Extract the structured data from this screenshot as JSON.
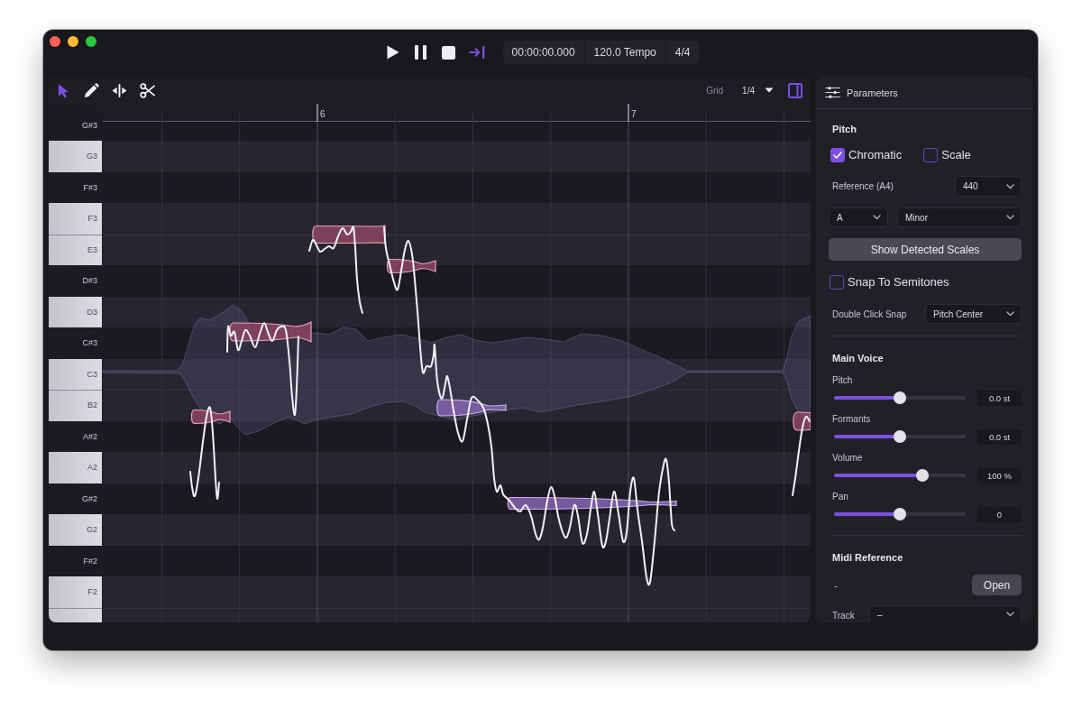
{
  "transport": {
    "buttons": [
      {
        "kind": "play",
        "on": false
      },
      {
        "kind": "pause",
        "on": false
      },
      {
        "kind": "stop",
        "on": false
      },
      {
        "kind": "end",
        "on": true
      }
    ],
    "readouts": [
      "00:00:00.000",
      "120.0 Tempo",
      "4/4"
    ]
  },
  "editor": {
    "tools": [
      {
        "kind": "pointer",
        "selected": true
      },
      {
        "kind": "pencil",
        "selected": false
      },
      {
        "kind": "split",
        "selected": false
      },
      {
        "kind": "scissors",
        "selected": false
      }
    ],
    "grid": {
      "label": "Grid",
      "value": "1/4"
    },
    "panel_toggle": {
      "on": true
    },
    "ruler": {
      "bars": [
        "6",
        "7"
      ]
    },
    "keys": [
      {
        "label": "G#3",
        "kind": "black"
      },
      {
        "label": "G3",
        "kind": "white"
      },
      {
        "label": "F#3",
        "kind": "black"
      },
      {
        "label": "F3",
        "kind": "white"
      },
      {
        "label": "E3",
        "kind": "white"
      },
      {
        "label": "D#3",
        "kind": "black"
      },
      {
        "label": "D3",
        "kind": "white"
      },
      {
        "label": "C#3",
        "kind": "black"
      },
      {
        "label": "C3",
        "kind": "white"
      },
      {
        "label": "B2",
        "kind": "white"
      },
      {
        "label": "A#2",
        "kind": "black"
      },
      {
        "label": "A2",
        "kind": "white"
      },
      {
        "label": "G#2",
        "kind": "black"
      },
      {
        "label": "G2",
        "kind": "white"
      },
      {
        "label": "F#2",
        "kind": "black"
      },
      {
        "label": "F2",
        "kind": "white"
      },
      {
        "kind": "white"
      }
    ],
    "notes": [
      {
        "selected": false
      },
      {
        "selected": false
      },
      {
        "selected": false
      },
      {
        "selected": false
      },
      {
        "selected": true
      },
      {
        "selected": true
      },
      {
        "selected": false
      }
    ]
  },
  "parameters": {
    "title": "Parameters",
    "pitch": {
      "heading": "Pitch",
      "modes": [
        {
          "label": "Chromatic",
          "checked": true
        },
        {
          "label": "Scale",
          "checked": false
        }
      ],
      "reference": {
        "label": "Reference (A4)",
        "value": "440"
      },
      "root": {
        "value": "A"
      },
      "scale": {
        "value": "Minor"
      },
      "detect_button": "Show Detected Scales",
      "snap": {
        "label": "Snap To Semitones",
        "checked": false
      },
      "double_click_snap": {
        "label": "Double Click Snap",
        "value": "Pitch Center"
      }
    },
    "main_voice": {
      "heading": "Main Voice",
      "sliders": [
        {
          "label": "Pitch",
          "level": 0.5,
          "reading": "0.0 st"
        },
        {
          "label": "Formants",
          "level": 0.5,
          "reading": "0.0 st"
        },
        {
          "label": "Volume",
          "level": 0.67,
          "reading": "100 %"
        },
        {
          "label": "Pan",
          "level": 0.5,
          "reading": "0"
        }
      ]
    },
    "midi_reference": {
      "heading": "Midi Reference",
      "file": "-",
      "button": "Open",
      "track": {
        "label": "Track",
        "value": "–"
      }
    }
  }
}
